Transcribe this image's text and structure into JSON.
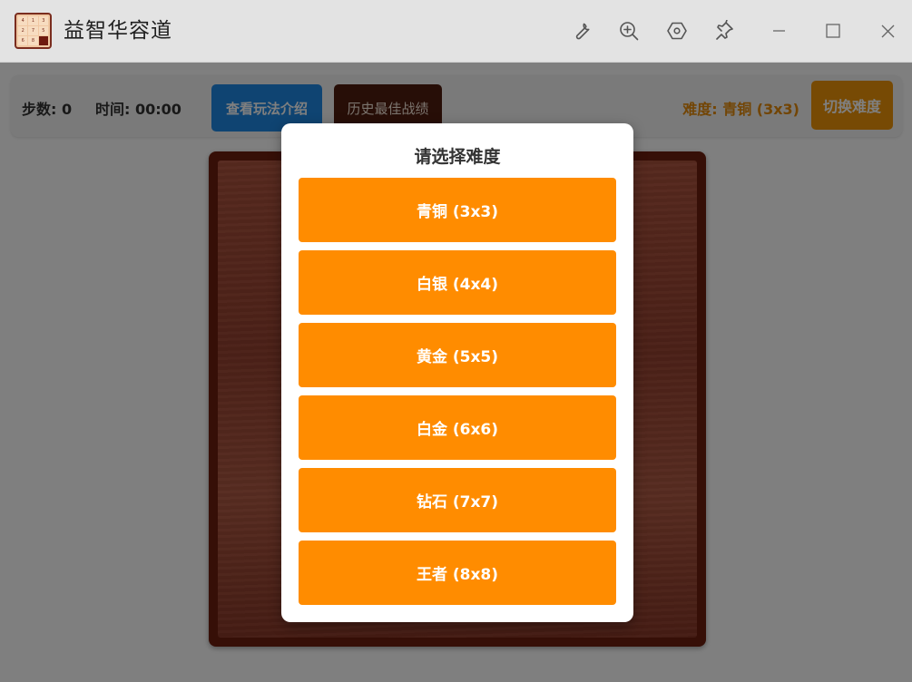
{
  "app": {
    "title": "益智华容道",
    "logo_digits": [
      "4",
      "1",
      "3",
      "2",
      "7",
      "5",
      "6",
      "8",
      ""
    ],
    "logo_icon": "puzzle-grid-logo"
  },
  "titlebar_icons": [
    "wrench-icon",
    "zoom-in-icon",
    "hexagon-settings-icon",
    "pin-icon",
    "minimize-icon",
    "maximize-icon",
    "close-icon"
  ],
  "toolbar": {
    "steps_label": "步数: 0",
    "time_label": "时间: 00:00",
    "rules_button": "查看玩法介绍",
    "best_button": "历史最佳战绩",
    "difficulty_label": "难度: 青铜 (3x3)",
    "switch_button": "切换难度"
  },
  "modal": {
    "title": "请选择难度",
    "levels": [
      {
        "label": "青铜 (3x3)"
      },
      {
        "label": "白银 (4x4)"
      },
      {
        "label": "黄金 (5x5)"
      },
      {
        "label": "白金 (6x6)"
      },
      {
        "label": "钻石 (7x7)"
      },
      {
        "label": "王者 (8x8)"
      }
    ]
  },
  "colors": {
    "level_button": "#ff8c00",
    "rules_button": "#1e88e5",
    "best_button": "#4e1d0e",
    "switch_button": "#ef9509",
    "board_frame": "#6d1f0f"
  }
}
